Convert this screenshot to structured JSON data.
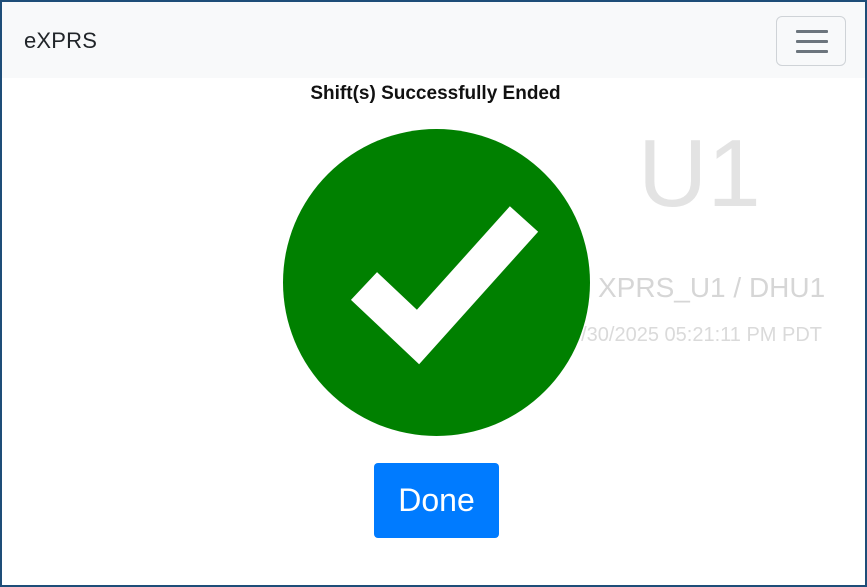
{
  "navbar": {
    "brand": "eXPRS",
    "menu_icon": "hamburger-menu-icon"
  },
  "background_info": {
    "unit": "U1",
    "route": "XPRS_U1 / DHU1",
    "timestamp": "6/30/2025 05:21:11 PM PDT"
  },
  "overlay": {
    "title": "Shift(s) Successfully Ended",
    "icon": "check-circle-icon",
    "done_label": "Done"
  },
  "colors": {
    "success": "#008000",
    "primary": "#007bff",
    "frame_border": "#1e4d78"
  }
}
